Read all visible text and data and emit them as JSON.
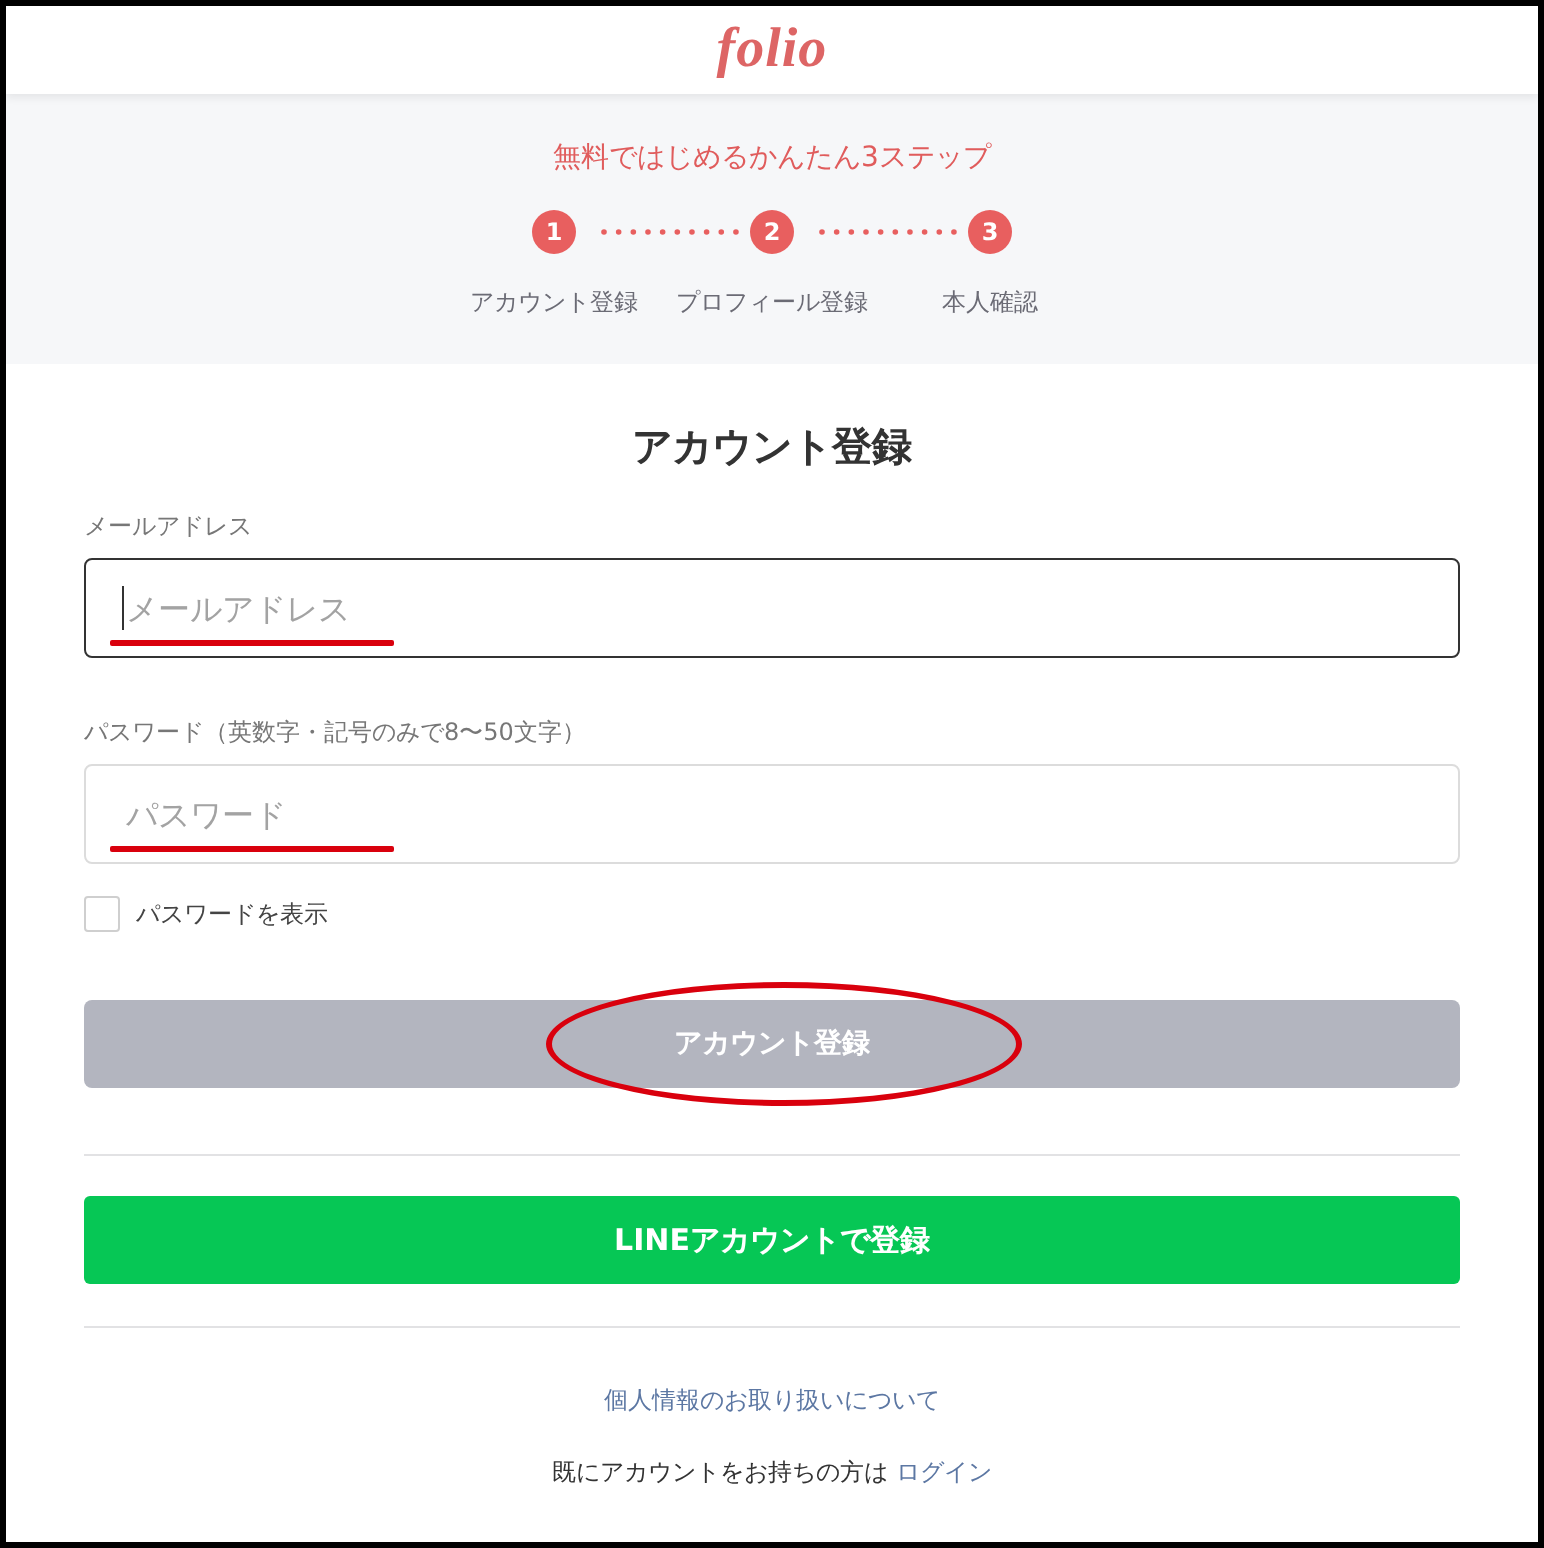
{
  "header": {
    "logo": "folio"
  },
  "steps_banner": {
    "title": "無料ではじめるかんたん3ステップ",
    "steps": [
      {
        "number": "1",
        "label": "アカウント登録"
      },
      {
        "number": "2",
        "label": "プロフィール登録"
      },
      {
        "number": "3",
        "label": "本人確認"
      }
    ]
  },
  "form": {
    "title": "アカウント登録",
    "fields": [
      {
        "label": "メールアドレス",
        "placeholder": "メールアドレス",
        "focused": true,
        "underlined": true
      },
      {
        "label": "パスワード（英数字・記号のみで8〜50文字）",
        "placeholder": "パスワード",
        "focused": false,
        "underlined": true
      }
    ],
    "show_password": {
      "label": "パスワードを表示",
      "checked": false
    },
    "submit_button": {
      "label": "アカウント登録",
      "disabled": true,
      "circled": true
    },
    "line_button": {
      "label": "LINEアカウントで登録"
    },
    "privacy_link": "個人情報のお取り扱いについて",
    "login_prompt": {
      "text": "既にアカウントをお持ちの方は",
      "link": "ログイン"
    }
  }
}
